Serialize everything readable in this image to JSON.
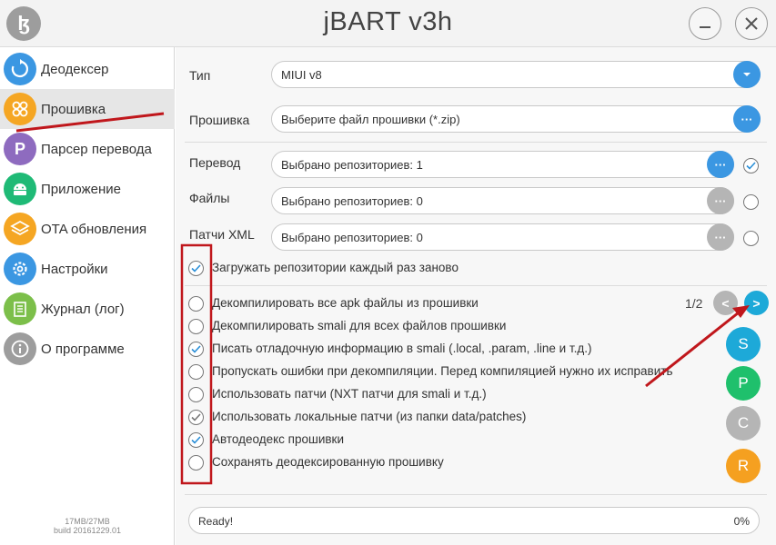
{
  "app": {
    "title": "jBART v3h",
    "logo_glyph": "ɮ"
  },
  "window_controls": {
    "minimize_icon": "minimize-icon",
    "close_icon": "close-icon"
  },
  "sidebar": {
    "items": [
      {
        "label": "Деодексер",
        "icon": "refresh-icon",
        "color": "#3b97e2",
        "glyph": ""
      },
      {
        "label": "Прошивка",
        "icon": "firmware-icon",
        "color": "#f5a623",
        "glyph": "",
        "active": true
      },
      {
        "label": "Парсер перевода",
        "icon": "parser-icon",
        "color": "#8e6bbf",
        "glyph": "P"
      },
      {
        "label": "Приложение",
        "icon": "android-icon",
        "color": "#1fba76",
        "glyph": ""
      },
      {
        "label": "OTA обновления",
        "icon": "layers-icon",
        "color": "#f5a623",
        "glyph": ""
      },
      {
        "label": "Настройки",
        "icon": "gear-icon",
        "color": "#3b97e2",
        "glyph": ""
      },
      {
        "label": "Журнал (лог)",
        "icon": "log-icon",
        "color": "#7cbf4a",
        "glyph": ""
      },
      {
        "label": "О программе",
        "icon": "info-icon",
        "color": "#9d9d9d",
        "glyph": ""
      }
    ],
    "mem_usage": "17MB/27MB",
    "build": "build 20161229.01"
  },
  "form": {
    "type_label": "Тип",
    "type_value": "MIUI v8",
    "firmware_label": "Прошивка",
    "firmware_placeholder": "Выберите файл прошивки (*.zip)",
    "translation_label": "Перевод",
    "translation_value": "Выбрано репозиториев: 1",
    "files_label": "Файлы",
    "files_value": "Выбрано репозиториев: 0",
    "patches_label": "Патчи XML",
    "patches_value": "Выбрано репозиториев: 0",
    "ellipsis": "···"
  },
  "reload_option": {
    "label": "Загружать репозитории каждый раз заново",
    "checked": true
  },
  "options": [
    {
      "label": "Декомпилировать все apk файлы из прошивки",
      "checked": false
    },
    {
      "label": "Декомпилировать smali для всех файлов прошивки",
      "checked": false
    },
    {
      "label": "Писать отладочную информацию в smali (.local, .param, .line и т.д.)",
      "checked": true
    },
    {
      "label": "Пропускать ошибки при декомпиляции. Перед компиляцией нужно их исправить",
      "checked": false
    },
    {
      "label": "Использовать патчи (NXT патчи для smali и т.д.)",
      "checked": false
    },
    {
      "label": "Использовать локальные патчи (из папки data/patches)",
      "checked": true
    },
    {
      "label": "Автодеодекс прошивки",
      "checked": true
    },
    {
      "label": "Сохранять деодексированную прошивку",
      "checked": false
    }
  ],
  "pager": {
    "text": "1/2",
    "prev": "<",
    "next": ">"
  },
  "mode_buttons": [
    {
      "label": "S",
      "color": "#1da9d8"
    },
    {
      "label": "P",
      "color": "#1fc06c"
    },
    {
      "label": "C",
      "color": "#b5b5b5"
    },
    {
      "label": "R",
      "color": "#f5a020"
    }
  ],
  "status": {
    "text": "Ready!",
    "progress": "0%"
  },
  "annotations": {
    "accent_color": "#c0171c"
  }
}
